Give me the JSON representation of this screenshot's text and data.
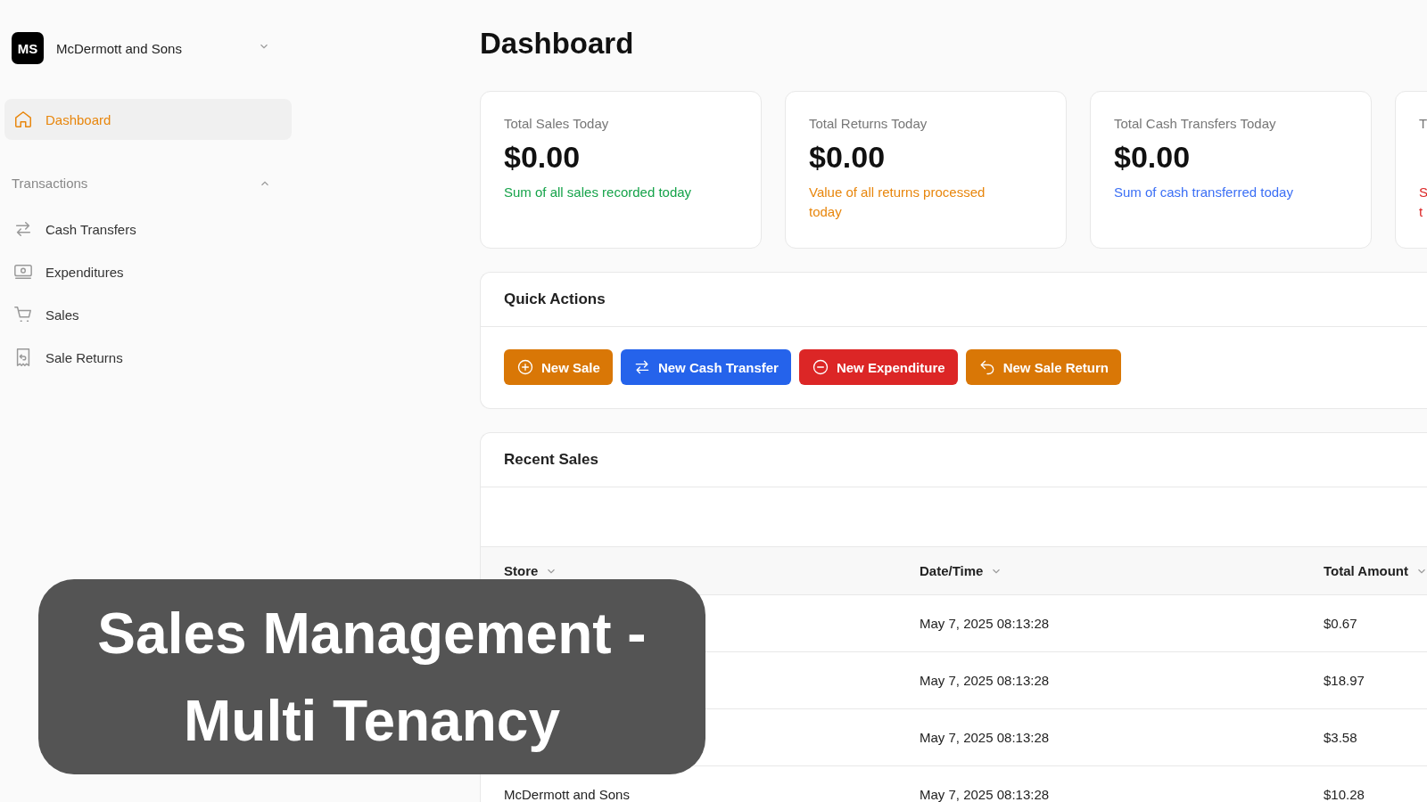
{
  "sidebar": {
    "org": {
      "initials": "MS",
      "name": "McDermott and Sons"
    },
    "items": [
      {
        "label": "Dashboard",
        "selected": true
      }
    ],
    "sections": [
      {
        "title": "Transactions",
        "expanded": true,
        "items": [
          {
            "label": "Cash Transfers",
            "selected": false
          },
          {
            "label": "Expenditures",
            "selected": false
          },
          {
            "label": "Sales",
            "selected": false
          },
          {
            "label": "Sale Returns",
            "selected": false
          }
        ]
      }
    ]
  },
  "page_title": "Dashboard",
  "stats": [
    {
      "title": "Total Sales Today",
      "value": "$0.00",
      "description_lines": [
        "Sum of all sales recorded today"
      ],
      "color": "#16a34a"
    },
    {
      "title": "Total Returns Today",
      "value": "$0.00",
      "description_lines": [
        "Value of all returns processed",
        "today"
      ],
      "color": "#e8860c"
    },
    {
      "title": "Total Cash Transfers Today",
      "value": "$0.00",
      "description_lines": [
        "Sum of cash transferred today"
      ],
      "color": "#3b6ff5"
    },
    {
      "title": "T",
      "description_lines": [
        "S",
        "t"
      ],
      "color": "#dc2626"
    }
  ],
  "quick_actions": {
    "title": "Quick Actions",
    "buttons": [
      {
        "label": "New Sale",
        "color": "#d97706"
      },
      {
        "label": "New Cash Transfer",
        "color": "#2563eb"
      },
      {
        "label": "New Expenditure",
        "color": "#dc2626"
      },
      {
        "label": "New Sale Return",
        "color": "#d97706"
      }
    ]
  },
  "recent_sales": {
    "title": "Recent Sales",
    "columns": [
      "Store",
      "Date/Time",
      "Total Amount"
    ],
    "rows": [
      {
        "date": "May 7, 2025 08:13:28",
        "amount": "$0.67"
      },
      {
        "date": "May 7, 2025 08:13:28",
        "amount": "$18.97"
      },
      {
        "date": "May 7, 2025 08:13:28",
        "amount": "$3.58"
      },
      {
        "store": "McDermott and Sons",
        "date": "May 7, 2025 08:13:28",
        "amount": "$10.28"
      }
    ]
  },
  "overlay_title_lines": [
    "Sales Management -",
    "Multi Tenancy"
  ]
}
